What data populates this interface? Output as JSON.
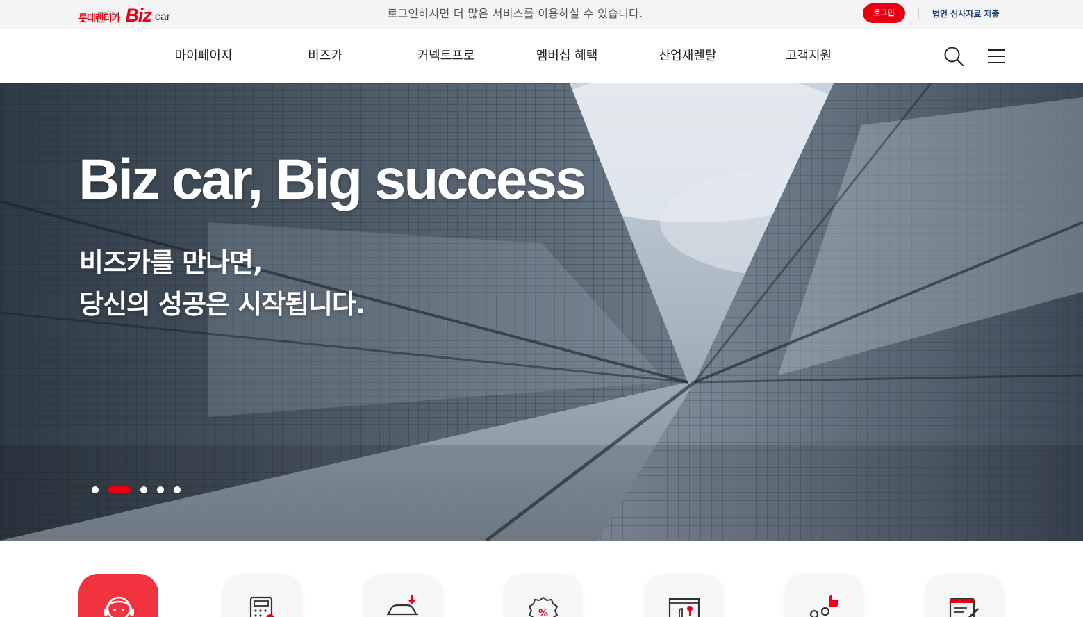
{
  "topbar": {
    "logo_kr": "롯데렌터카",
    "logo_tag": "대한민국 No.1",
    "logo_biz": "Biz",
    "logo_car": "car",
    "notice": "로그인하시면 더 많은 서비스를 이용하실 수 있습니다.",
    "login_label": "로그인",
    "corp_link": "법인 심사자료 제출"
  },
  "gnb": {
    "items": [
      {
        "label": "마이페이지"
      },
      {
        "label": "비즈카"
      },
      {
        "label": "커넥트프로"
      },
      {
        "label": "멤버십 혜택"
      },
      {
        "label": "산업재렌탈"
      },
      {
        "label": "고객지원"
      }
    ]
  },
  "hero": {
    "title": "Biz car, Big success",
    "sub_line1": "비즈카를 만나면,",
    "sub_line2": "당신의 성공은 시작됩니다.",
    "slide_count": 5,
    "active_slide": 2
  },
  "quick_icons": [
    {
      "icon": "consultant-icon",
      "active": true
    },
    {
      "icon": "calculator-icon",
      "active": false
    },
    {
      "icon": "car-download-icon",
      "active": false
    },
    {
      "icon": "discount-badge-icon",
      "active": false
    },
    {
      "icon": "map-pin-icon",
      "active": false
    },
    {
      "icon": "thumbs-up-people-icon",
      "active": false
    },
    {
      "icon": "document-edit-icon",
      "active": false
    }
  ],
  "colors": {
    "brand": "#e60012",
    "link": "#1a3b7a"
  }
}
